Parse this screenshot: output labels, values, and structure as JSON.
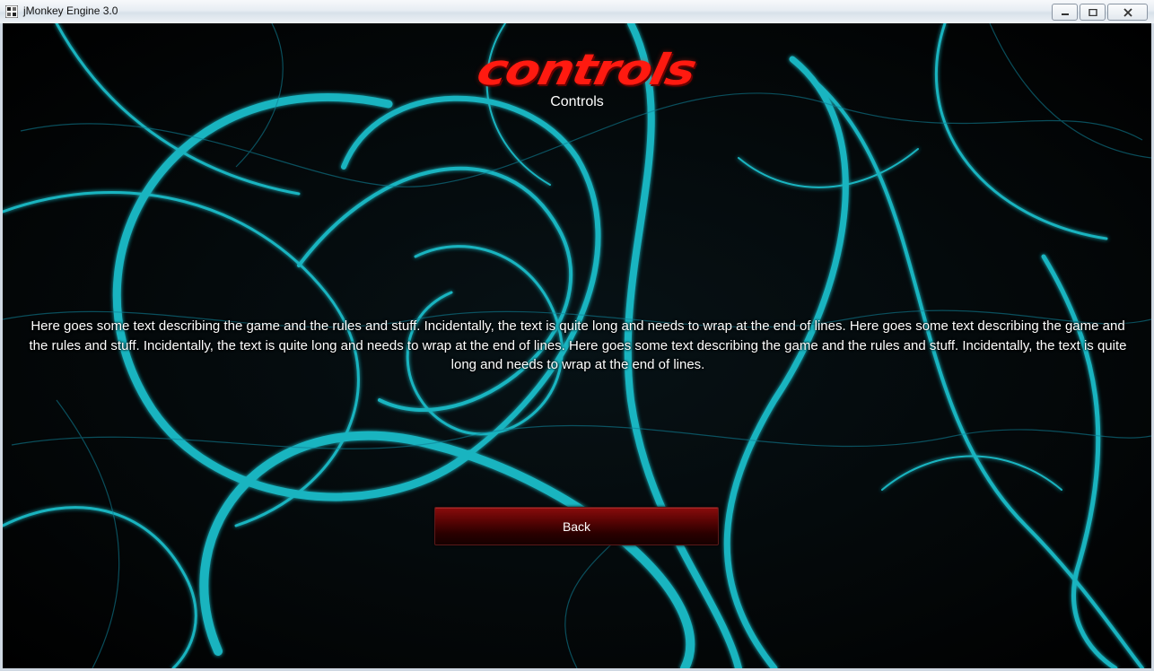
{
  "window": {
    "title": "jMonkey Engine 3.0",
    "icon": "jmonkey-app-icon",
    "controls": [
      "minimize-icon",
      "maximize-icon",
      "close-icon"
    ]
  },
  "screen": {
    "logo_text": "controls",
    "heading": "Controls",
    "description": "Here goes some text describing the game and the rules and stuff. Incidentally, the text is quite long and needs to wrap at the end of lines. Here goes some text describing the game and the rules and stuff. Incidentally, the text is quite long and needs to wrap at the end of lines. Here goes some text describing the game and the rules and stuff. Incidentally, the text is quite long and needs to wrap at the end of lines.",
    "back_label": "Back"
  },
  "colors": {
    "logo": "#ff1a10",
    "button": "#5a0404",
    "background_swirls": "#19c4d2"
  }
}
